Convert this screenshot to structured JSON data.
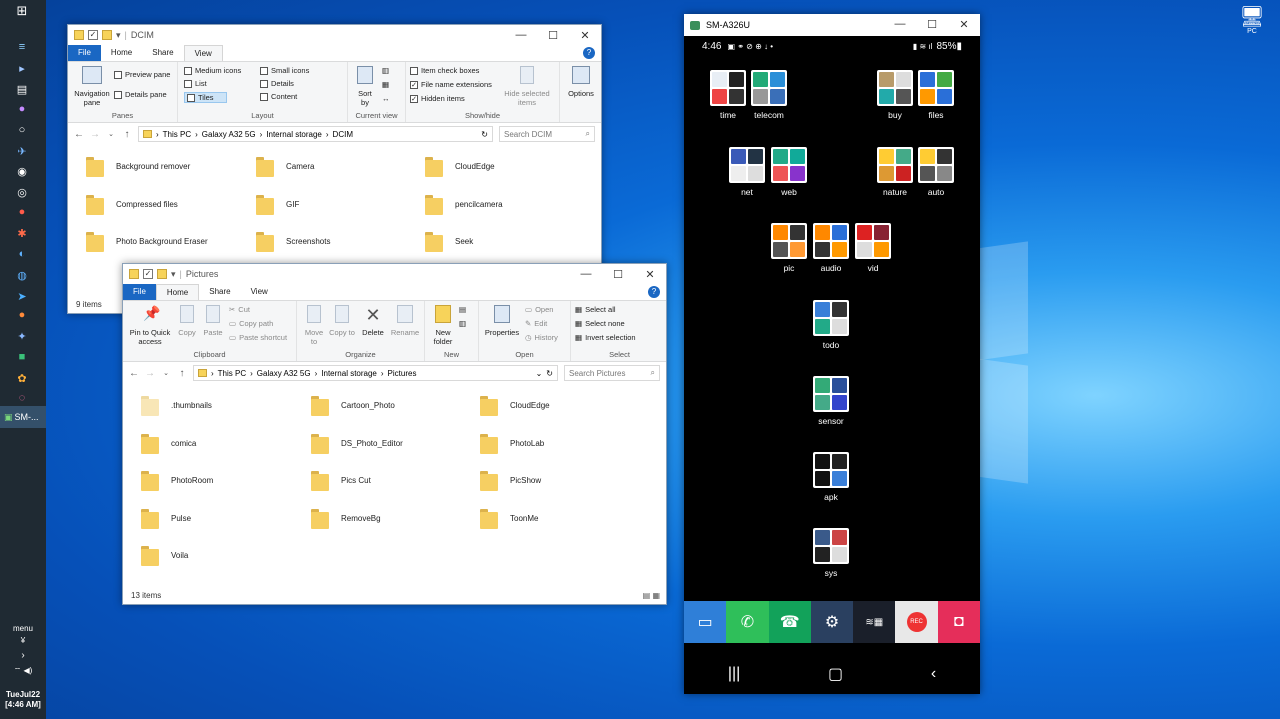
{
  "taskbar": {
    "active_app": "SM-...",
    "menu_label": "menu",
    "date": "TueJul22",
    "time": "[4:46 AM]"
  },
  "dcim_window": {
    "title": "DCIM",
    "tabs": [
      "File",
      "Home",
      "Share",
      "View"
    ],
    "ribbon": {
      "panes": {
        "nav_pane": "Navigation pane",
        "preview": "Preview pane",
        "details": "Details pane",
        "label": "Panes"
      },
      "layout": {
        "medium": "Medium icons",
        "small": "Small icons",
        "list": "List",
        "details": "Details",
        "tiles": "Tiles",
        "content": "Content",
        "label": "Layout"
      },
      "current_view": {
        "sort": "Sort by",
        "label": "Current view"
      },
      "show_hide": {
        "item_check": "Item check boxes",
        "extensions": "File name extensions",
        "hidden": "Hidden items",
        "hide_selected": "Hide selected items",
        "label": "Show/hide"
      },
      "options": "Options"
    },
    "path": [
      "This PC",
      "Galaxy A32 5G",
      "Internal storage",
      "DCIM"
    ],
    "search_placeholder": "Search DCIM",
    "folders": [
      "Background remover",
      "Camera",
      "CloudEdge",
      "Compressed files",
      "GIF",
      "pencilcamera",
      "Photo Background Eraser",
      "Screenshots",
      "Seek"
    ],
    "status": "9 items"
  },
  "pictures_window": {
    "title": "Pictures",
    "tabs": [
      "File",
      "Home",
      "Share",
      "View"
    ],
    "ribbon": {
      "clipboard": {
        "pin": "Pin to Quick access",
        "copy": "Copy",
        "paste": "Paste",
        "cut": "Cut",
        "copy_path": "Copy path",
        "paste_shortcut": "Paste shortcut",
        "label": "Clipboard"
      },
      "organize": {
        "move": "Move to",
        "copy": "Copy to",
        "delete": "Delete",
        "rename": "Rename",
        "label": "Organize"
      },
      "new": {
        "folder": "New folder",
        "label": "New"
      },
      "open": {
        "properties": "Properties",
        "open": "Open",
        "edit": "Edit",
        "history": "History",
        "label": "Open"
      },
      "select": {
        "all": "Select all",
        "none": "Select none",
        "invert": "Invert selection",
        "label": "Select"
      }
    },
    "path": [
      "This PC",
      "Galaxy A32 5G",
      "Internal storage",
      "Pictures"
    ],
    "search_placeholder": "Search Pictures",
    "folders": [
      ".thumbnails",
      "Cartoon_Photo",
      "CloudEdge",
      "comica",
      "DS_Photo_Editor",
      "PhotoLab",
      "PhotoRoom",
      "Pics Cut",
      "PicShow",
      "Pulse",
      "RemoveBg",
      "ToonMe",
      "Voila"
    ],
    "status": "13 items"
  },
  "phone": {
    "title": "SM-A326U",
    "status_time": "4:46",
    "battery": "85%",
    "groups": [
      "time",
      "telecom",
      "buy",
      "files",
      "net",
      "web",
      "nature",
      "auto",
      "pic",
      "audio",
      "vid",
      "todo",
      "sensor",
      "apk",
      "sys"
    ],
    "rec_label": "REC"
  },
  "desktop": {
    "pc_label": "PC"
  }
}
